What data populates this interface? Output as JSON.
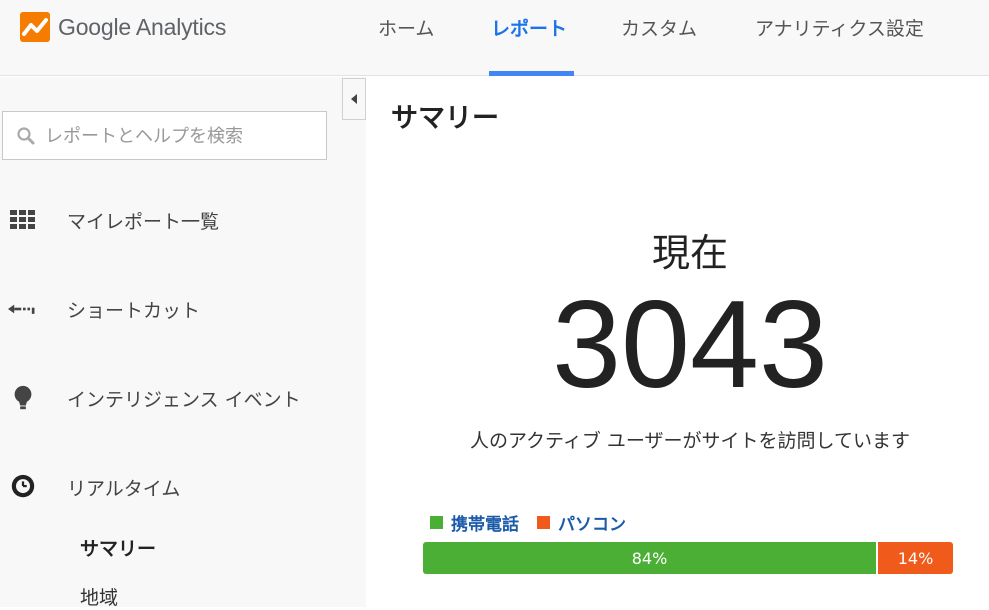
{
  "app": {
    "logo_text": "Google Analytics"
  },
  "nav": {
    "items": [
      {
        "label": "ホーム"
      },
      {
        "label": "レポート"
      },
      {
        "label": "カスタム"
      },
      {
        "label": "アナリティクス設定"
      }
    ],
    "active": "レポート"
  },
  "sidebar": {
    "search_placeholder": "レポートとヘルプを検索",
    "items": [
      {
        "label": "マイレポート一覧",
        "icon": "grid-icon"
      },
      {
        "label": "ショートカット",
        "icon": "shortcut-arrow-icon"
      },
      {
        "label": "インテリジェンス イベント",
        "icon": "lightbulb-icon"
      },
      {
        "label": "リアルタイム",
        "icon": "clock-icon"
      }
    ],
    "sub_items": [
      {
        "label": "サマリー",
        "active": true
      },
      {
        "label": "地域",
        "active": false
      }
    ]
  },
  "main": {
    "title": "サマリー",
    "now_label": "現在",
    "active_users": "3043",
    "visit_text": "人のアクティブ ユーザーがサイトを訪問しています",
    "legend": [
      {
        "label": "携帯電話",
        "color": "#4caf35"
      },
      {
        "label": "パソコン",
        "color": "#f05a1a"
      }
    ],
    "device_split": [
      {
        "label": "84%",
        "value": 84,
        "color": "#4caf35"
      },
      {
        "label": "14%",
        "value": 14,
        "color": "#f05a1a"
      }
    ]
  },
  "colors": {
    "accent": "#1a73e8",
    "logo_orange": "#f57c00"
  }
}
